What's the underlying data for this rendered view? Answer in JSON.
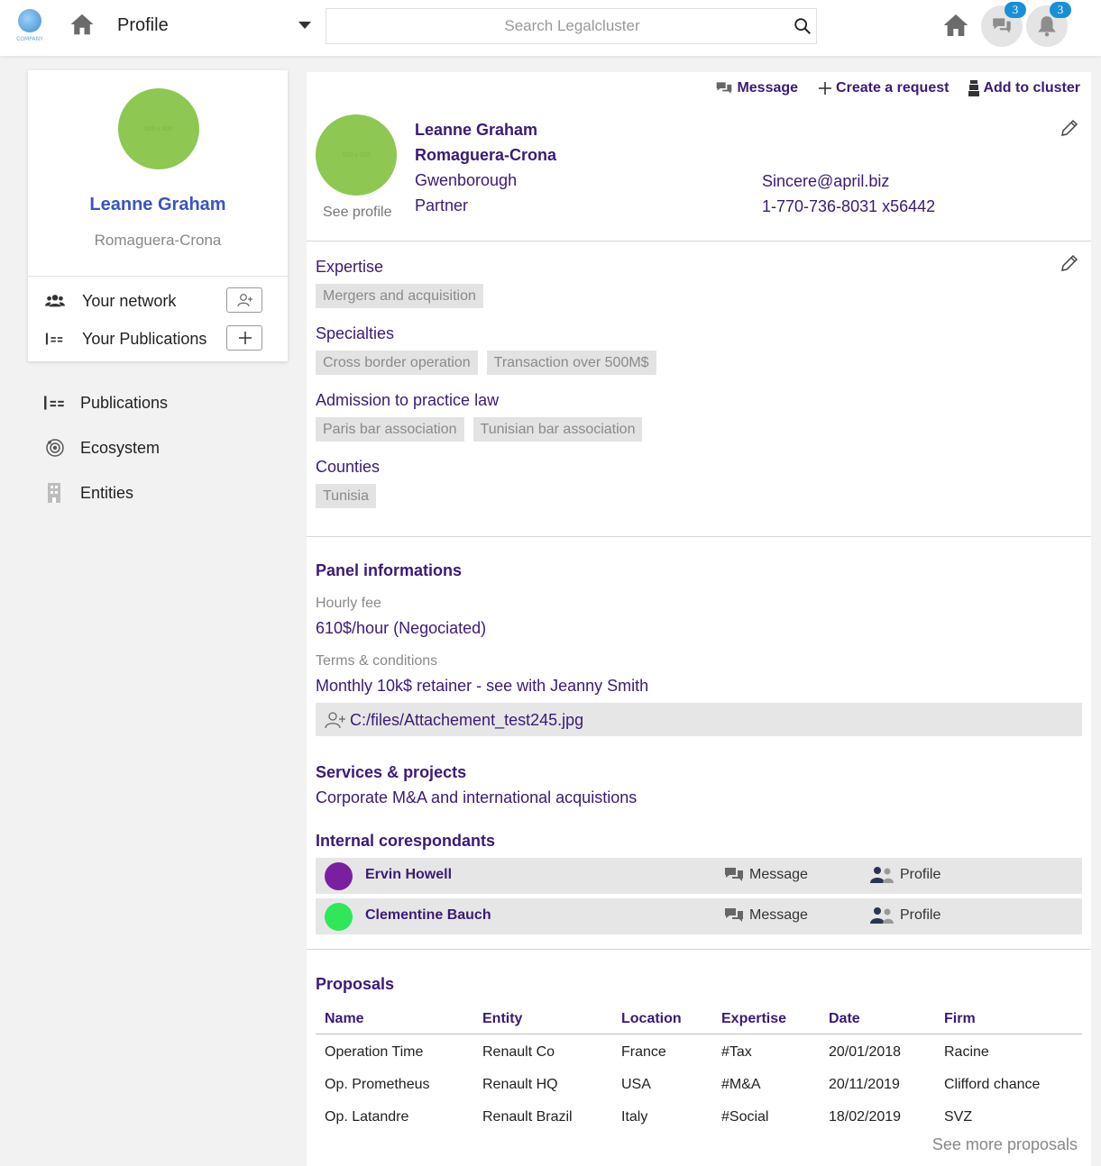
{
  "header": {
    "logo_text": "COMPANY",
    "title": "Profile",
    "search_placeholder": "Search Legalcluster",
    "messages_badge": "3",
    "notifications_badge": "3"
  },
  "sidebar": {
    "avatar_text": "600 x 600",
    "name": "Leanne Graham",
    "firm": "Romaguera-Crona",
    "your_network": "Your network",
    "your_publications": "Your Publications",
    "nav": [
      {
        "label": "Publications",
        "icon": "publications-icon"
      },
      {
        "label": "Ecosystem",
        "icon": "ecosystem-icon"
      },
      {
        "label": "Entities",
        "icon": "entities-icon"
      }
    ]
  },
  "profile": {
    "actions": {
      "message": "Message",
      "create_request": "Create a request",
      "add_to_cluster": "Add to cluster"
    },
    "avatar_text": "150 x 150",
    "see_profile": "See profile",
    "name": "Leanne Graham",
    "firm": "Romaguera-Crona",
    "city": "Gwenborough",
    "role": "Partner",
    "email": "Sincere@april.biz",
    "phone": "1-770-736-8031 x56442"
  },
  "expertise": {
    "expertise_label": "Expertise",
    "expertise_tags": [
      "Mergers and acquisition"
    ],
    "specialties_label": "Specialties",
    "specialties_tags": [
      "Cross border operation",
      "Transaction over 500M$"
    ],
    "admission_label": "Admission to practice law",
    "admission_tags": [
      "Paris bar association",
      "Tunisian bar association"
    ],
    "counties_label": "Counties",
    "counties_tags": [
      "Tunisia"
    ]
  },
  "panel": {
    "title": "Panel informations",
    "hourly_fee_label": "Hourly fee",
    "hourly_fee": "610$/hour (Negociated)",
    "terms_label": "Terms & conditions",
    "terms": "Monthly 10k$ retainer - see with Jeanny Smith",
    "attachment": "C:/files/Attachement_test245.jpg",
    "services_title": "Services & projects",
    "services": "Corporate M&A and international acquistions",
    "correspondants_title": "Internal corespondants",
    "correspondants": [
      {
        "name": "Ervin Howell",
        "message": "Message",
        "profile": "Profile",
        "avatar_color": "#7b1fa2",
        "avatar_text": "30 x 30"
      },
      {
        "name": "Clementine Bauch",
        "message": "Message",
        "profile": "Profile",
        "avatar_color": "#2ee85a",
        "avatar_text": ""
      }
    ]
  },
  "proposals": {
    "title": "Proposals",
    "columns": [
      "Name",
      "Entity",
      "Location",
      "Expertise",
      "Date",
      "Firm"
    ],
    "rows": [
      [
        "Operation Time",
        "Renault Co",
        "France",
        "#Tax",
        "20/01/2018",
        "Racine"
      ],
      [
        "Op. Prometheus",
        "Renault HQ",
        "USA",
        "#M&A",
        "20/11/2019",
        "Clifford chance"
      ],
      [
        "Op. Latandre",
        "Renault Brazil",
        "Italy",
        "#Social",
        "18/02/2019",
        "SVZ"
      ]
    ],
    "see_more": "See more proposals"
  }
}
